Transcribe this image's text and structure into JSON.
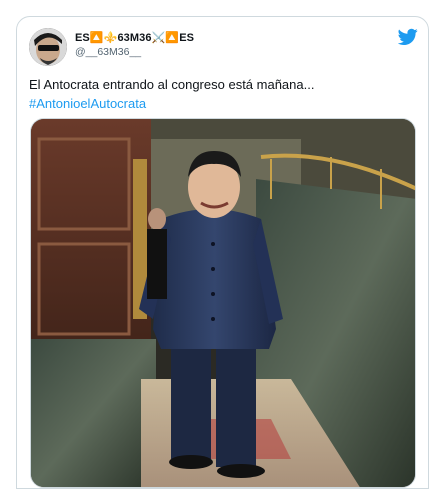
{
  "tweet": {
    "display_name": "ES🔼⚜️63M36⚔️🔼ES",
    "handle": "@__63M36__",
    "text": "El Antocrata entrando al congreso está mañana...",
    "hashtag": "#AntonioelAutocrata",
    "brand_color": "#1d9bf0",
    "logo_icon": "twitter-bird-icon"
  },
  "media": {
    "description_icon": "photo-icon"
  }
}
